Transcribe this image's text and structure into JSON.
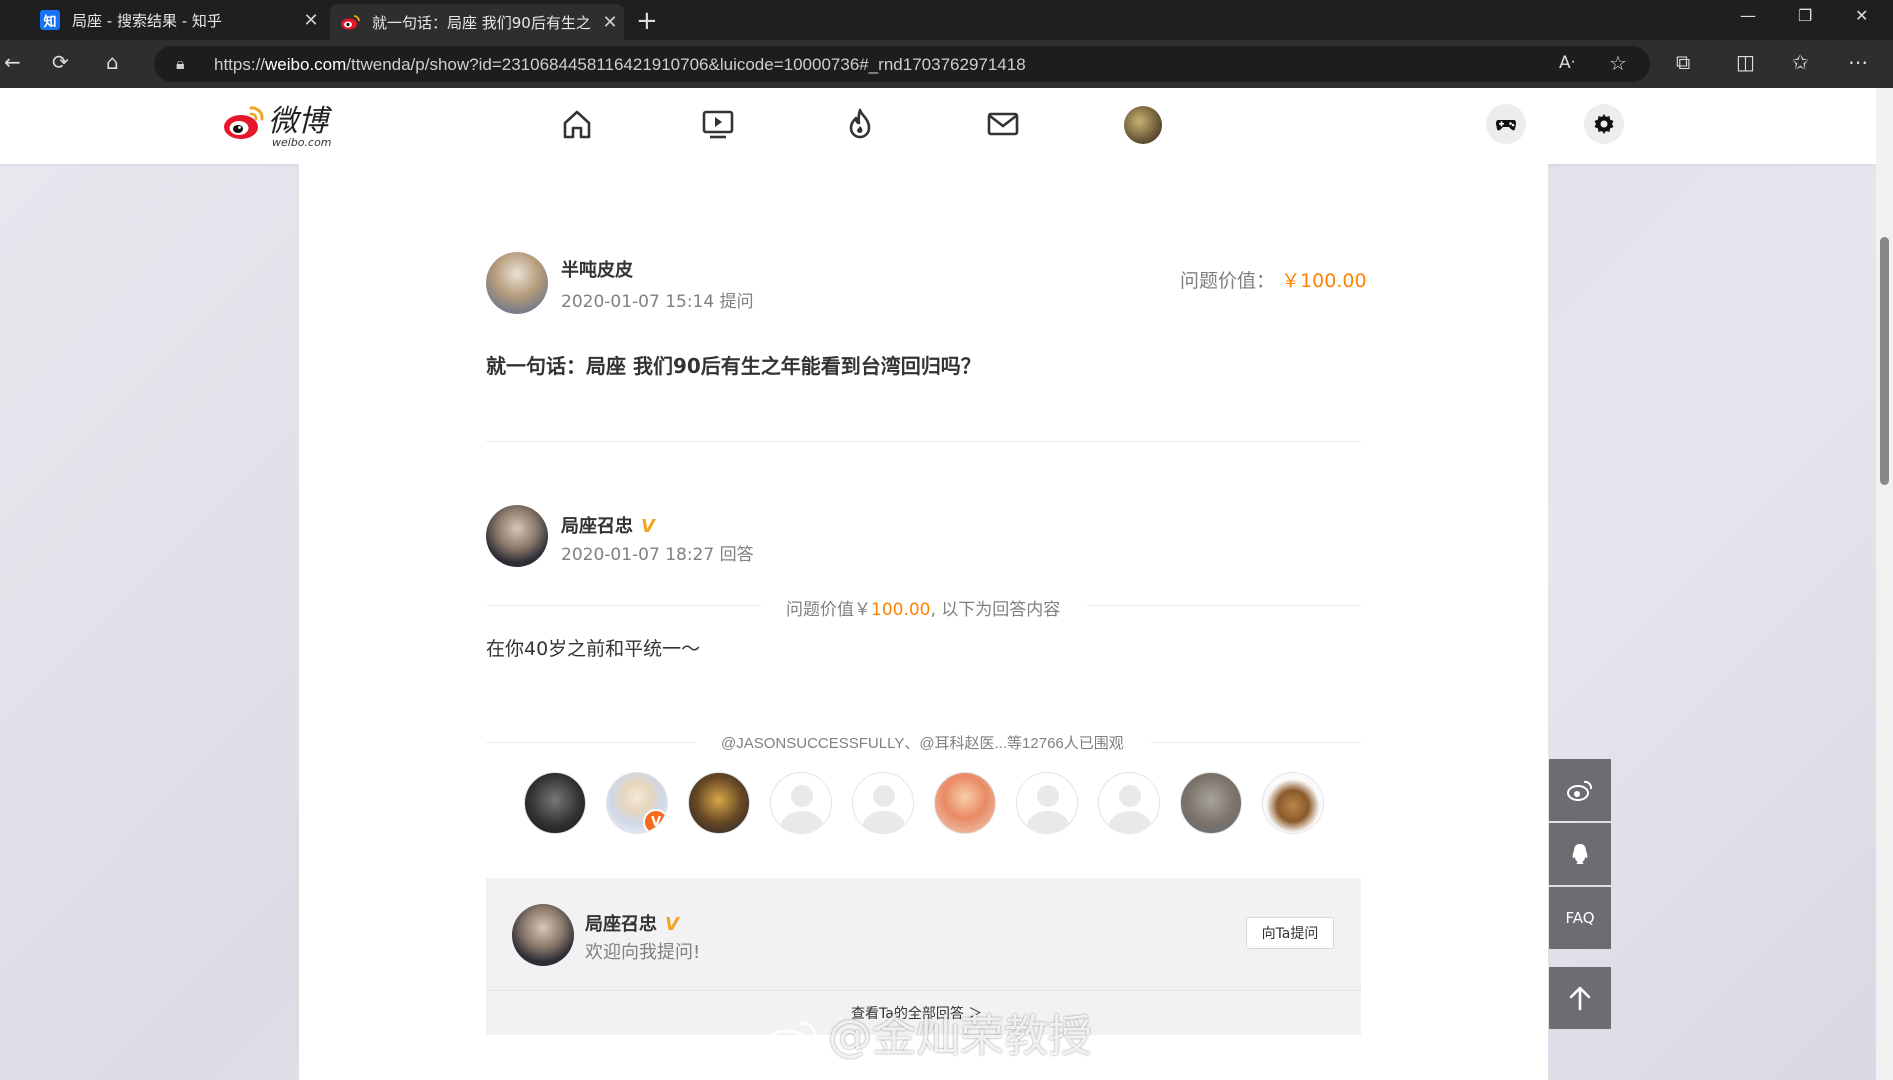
{
  "browser": {
    "tabs": [
      {
        "favicon": "知",
        "title": "局座 - 搜索结果 - 知乎",
        "active": false
      },
      {
        "favicon": "weibo",
        "title": "就一句话：局座 我们90后有生之",
        "active": true
      }
    ],
    "url_prefix": "https://",
    "url_domain": "weibo.com",
    "url_path": "/ttwenda/p/show?id=2310684458116421910706&luicode=10000736#_rnd1703762971418"
  },
  "nav": {
    "logo_text": "微博",
    "logo_sub": "weibo.com",
    "icons": [
      "home-icon",
      "video-icon",
      "hot-icon",
      "mail-icon"
    ]
  },
  "question": {
    "asker_name": "半吨皮皮",
    "asked_time": "2020-01-07 15:14 提问",
    "value_label": "问题价值：",
    "value_amount": "￥100.00",
    "title": "就一句话：局座 我们90后有生之年能看到台湾回归吗？"
  },
  "answer": {
    "answerer_name": "局座召忠",
    "verified": "V",
    "answered_time": "2020-01-07 18:27 回答",
    "value_prefix": "问题价值￥",
    "value_amount": "100.00",
    "value_suffix": ", 以下为回答内容",
    "content": "在你40岁之前和平统一～"
  },
  "watchers": {
    "summary": "@JASONSUCCESSFULLY、@耳科赵医...等12766人已围观"
  },
  "profile": {
    "name": "局座召忠",
    "verified": "V",
    "welcome": "欢迎向我提问!",
    "ask_button": "向Ta提问",
    "all_answers": "查看Ta的全部回答 ＞"
  },
  "side_buttons": {
    "faq": "FAQ"
  },
  "watermark": "@金灿荣教授",
  "colors": {
    "accent": "#ff8200",
    "verified": "#f0a51e"
  }
}
